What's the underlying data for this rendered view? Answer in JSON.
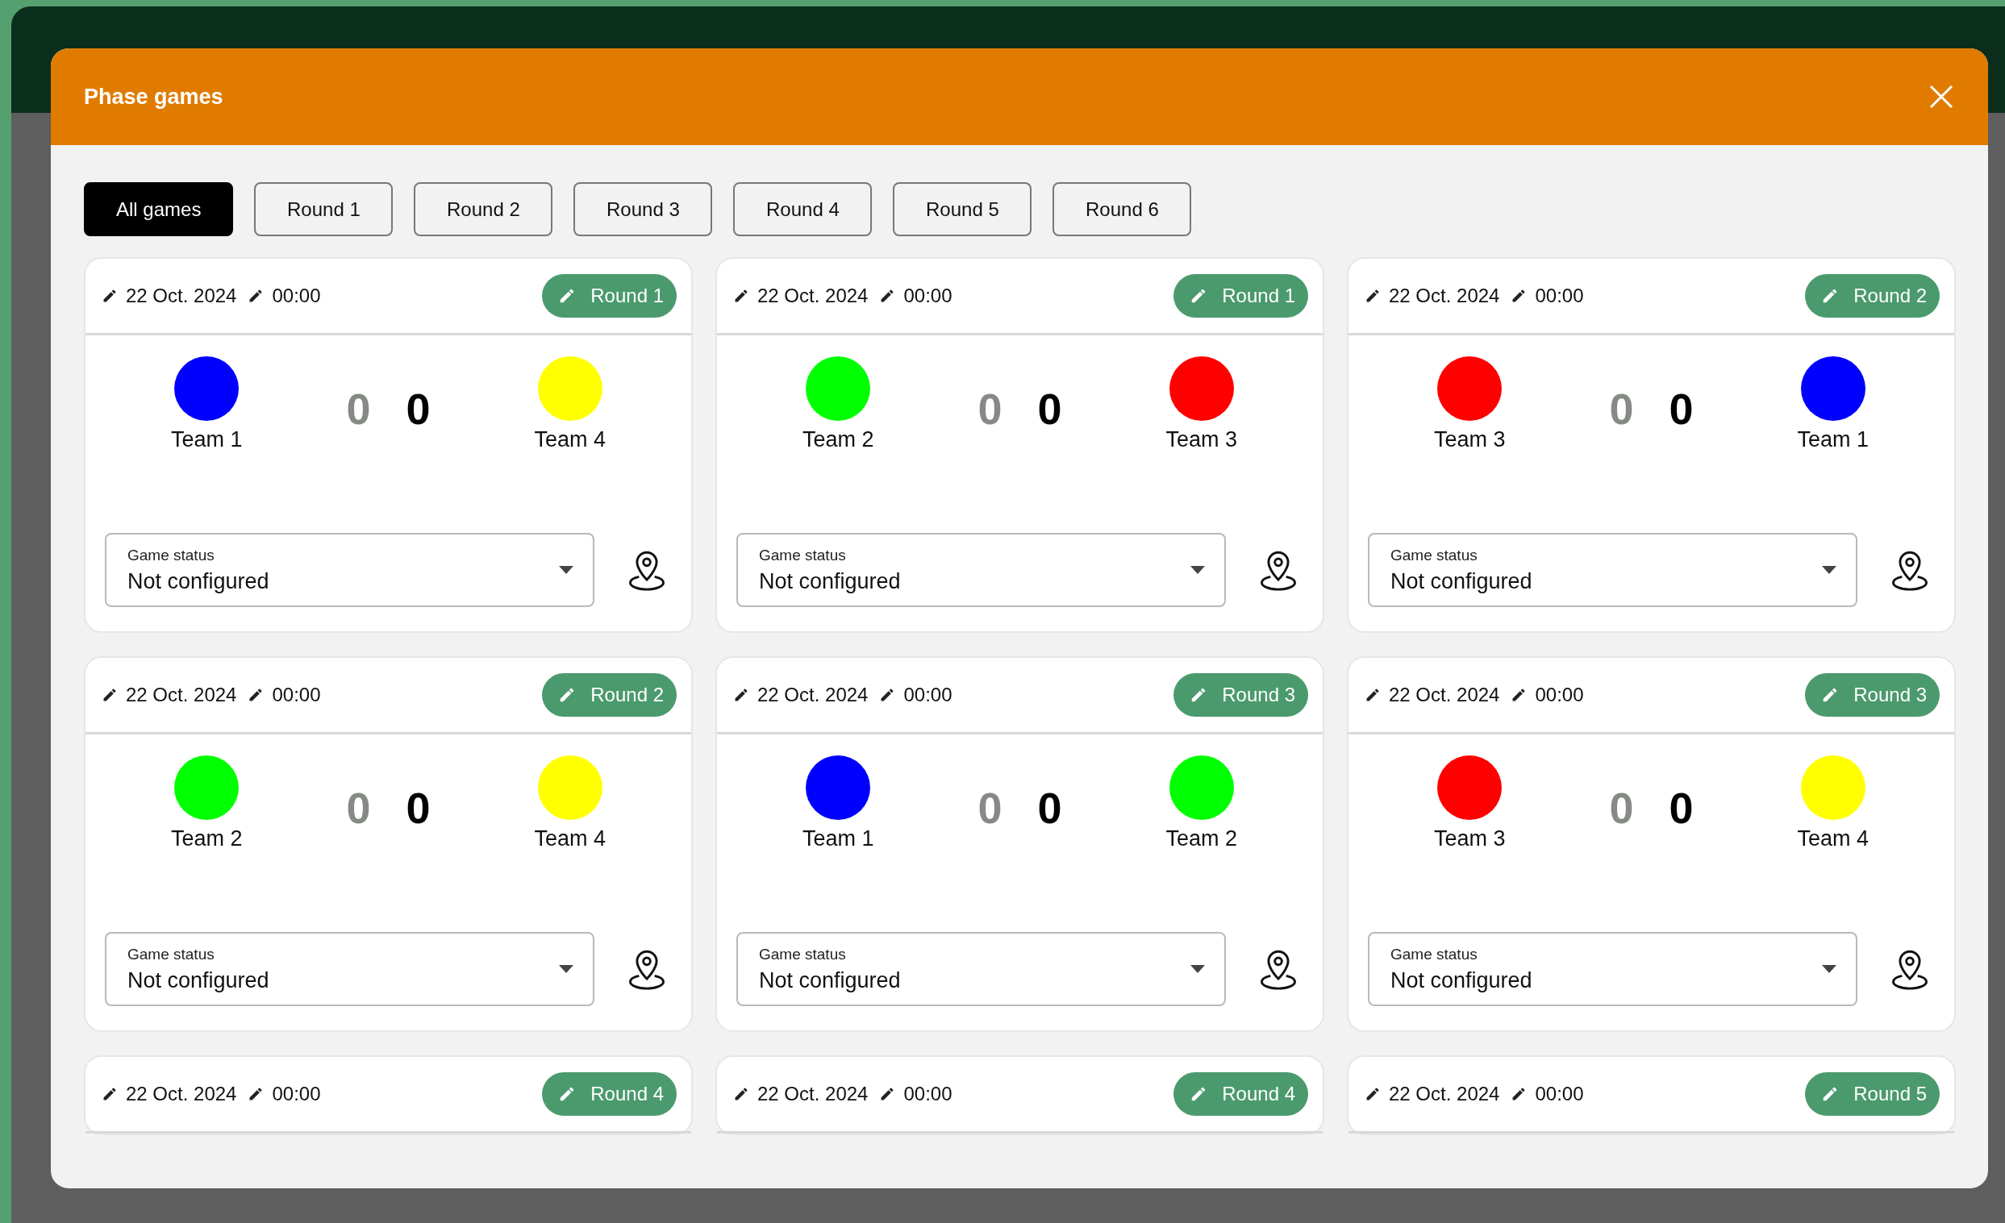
{
  "dialog": {
    "title": "Phase games"
  },
  "filters": [
    {
      "label": "All games",
      "selected": true
    },
    {
      "label": "Round 1",
      "selected": false
    },
    {
      "label": "Round 2",
      "selected": false
    },
    {
      "label": "Round 3",
      "selected": false
    },
    {
      "label": "Round 4",
      "selected": false
    },
    {
      "label": "Round 5",
      "selected": false
    },
    {
      "label": "Round 6",
      "selected": false
    }
  ],
  "games": [
    {
      "date": "22 Oct. 2024",
      "time": "00:00",
      "round": "Round 1",
      "home": {
        "name": "Team 1",
        "color": "#0000ff",
        "score": "0"
      },
      "away": {
        "name": "Team 4",
        "color": "#ffff00",
        "score": "0"
      },
      "status": {
        "label": "Game status",
        "value": "Not configured"
      }
    },
    {
      "date": "22 Oct. 2024",
      "time": "00:00",
      "round": "Round 1",
      "home": {
        "name": "Team 2",
        "color": "#00ff00",
        "score": "0"
      },
      "away": {
        "name": "Team 3",
        "color": "#ff0000",
        "score": "0"
      },
      "status": {
        "label": "Game status",
        "value": "Not configured"
      }
    },
    {
      "date": "22 Oct. 2024",
      "time": "00:00",
      "round": "Round 2",
      "home": {
        "name": "Team 3",
        "color": "#ff0000",
        "score": "0"
      },
      "away": {
        "name": "Team 1",
        "color": "#0000ff",
        "score": "0"
      },
      "status": {
        "label": "Game status",
        "value": "Not configured"
      }
    },
    {
      "date": "22 Oct. 2024",
      "time": "00:00",
      "round": "Round 2",
      "home": {
        "name": "Team 2",
        "color": "#00ff00",
        "score": "0"
      },
      "away": {
        "name": "Team 4",
        "color": "#ffff00",
        "score": "0"
      },
      "status": {
        "label": "Game status",
        "value": "Not configured"
      }
    },
    {
      "date": "22 Oct. 2024",
      "time": "00:00",
      "round": "Round 3",
      "home": {
        "name": "Team 1",
        "color": "#0000ff",
        "score": "0"
      },
      "away": {
        "name": "Team 2",
        "color": "#00ff00",
        "score": "0"
      },
      "status": {
        "label": "Game status",
        "value": "Not configured"
      }
    },
    {
      "date": "22 Oct. 2024",
      "time": "00:00",
      "round": "Round 3",
      "home": {
        "name": "Team 3",
        "color": "#ff0000",
        "score": "0"
      },
      "away": {
        "name": "Team 4",
        "color": "#ffff00",
        "score": "0"
      },
      "status": {
        "label": "Game status",
        "value": "Not configured"
      }
    },
    {
      "date": "22 Oct. 2024",
      "time": "00:00",
      "round": "Round 4"
    },
    {
      "date": "22 Oct. 2024",
      "time": "00:00",
      "round": "Round 4"
    },
    {
      "date": "22 Oct. 2024",
      "time": "00:00",
      "round": "Round 5"
    }
  ]
}
